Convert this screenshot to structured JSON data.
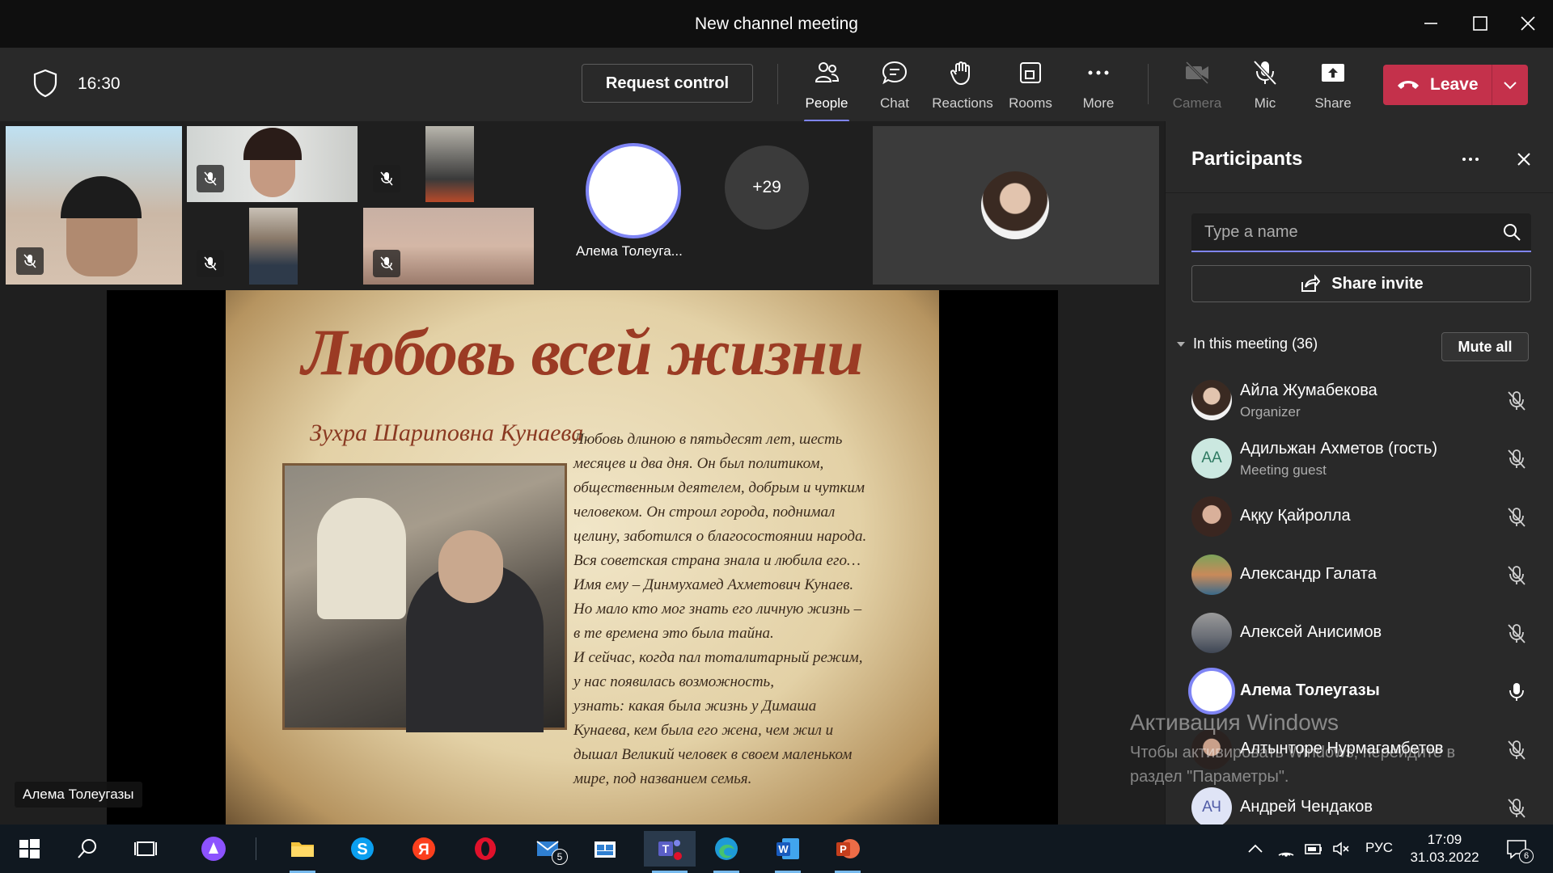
{
  "window": {
    "title": "New channel meeting"
  },
  "toolbar": {
    "timer": "16:30",
    "request_control": "Request control",
    "items": [
      {
        "label": "People",
        "icon": "people-icon",
        "active": true
      },
      {
        "label": "Chat",
        "icon": "chat-icon"
      },
      {
        "label": "Reactions",
        "icon": "reactions-icon"
      },
      {
        "label": "Rooms",
        "icon": "rooms-icon"
      },
      {
        "label": "More",
        "icon": "more-icon"
      },
      {
        "label": "Camera",
        "icon": "camera-off-icon",
        "disabled": true
      },
      {
        "label": "Mic",
        "icon": "mic-off-icon"
      },
      {
        "label": "Share",
        "icon": "share-icon"
      }
    ],
    "leave": "Leave"
  },
  "stage": {
    "featured_name": "Алема Толеуга...",
    "overflow_count": "+29",
    "presenter_tag": "Алема Толеугазы"
  },
  "slide": {
    "title": "Любовь всей жизни",
    "subtitle": "Зухра Шариповна Кунаева",
    "lines": [
      "Любовь длиною в пятьдесят лет, шесть",
      "месяцев и два дня. Он был политиком,",
      "общественным деятелем, добрым и чутким",
      "человеком. Он строил города, поднимал",
      "целину, заботился о благосостоянии народа.",
      "Вся советская страна знала и любила его…",
      "Имя ему – Динмухамед Ахметович Кунаев.",
      "Но мало кто мог знать его личную жизнь –",
      "в те времена это была тайна.",
      "И сейчас, когда пал тоталитарный режим,",
      "у нас появилась возможность,",
      "узнать: какая была жизнь у Димаша",
      "Кунаева, кем была его жена, чем жил и",
      "дышал Великий человек в своем маленьком",
      "мире, под названием семья."
    ]
  },
  "panel": {
    "title": "Participants",
    "search_placeholder": "Type a name",
    "share_invite": "Share invite",
    "section_label": "In this meeting (36)",
    "mute_all": "Mute all",
    "participants": [
      {
        "name": "Айла Жумабекова",
        "sub": "Organizer",
        "avatar": "photo",
        "mic": "off"
      },
      {
        "name": "Адильжан Ахметов (гость)",
        "sub": "Meeting guest",
        "avatar": "initials",
        "initials": "АА",
        "mic": "off"
      },
      {
        "name": "Аққу Қайролла",
        "sub": "",
        "avatar": "photo",
        "mic": "off"
      },
      {
        "name": "Александр Галата",
        "sub": "",
        "avatar": "photo",
        "mic": "off"
      },
      {
        "name": "Алексей Анисимов",
        "sub": "",
        "avatar": "photo",
        "mic": "off"
      },
      {
        "name": "Алема Толеугазы",
        "sub": "",
        "avatar": "ring",
        "mic": "on"
      },
      {
        "name": "Алтынторе Нурмагамбетов",
        "sub": "",
        "avatar": "photo",
        "mic": "off"
      },
      {
        "name": "Андрей Чендаков",
        "sub": "",
        "avatar": "initials",
        "initials": "АЧ",
        "mic": "off"
      }
    ]
  },
  "watermark": {
    "line1": "Активация Windows",
    "line2": "Чтобы активировать Windows, перейдите в раздел \"Параметры\"."
  },
  "taskbar": {
    "lang": "РУС",
    "time": "17:09",
    "date": "31.03.2022",
    "mail_badge": "5",
    "notif_badge": "6"
  },
  "colors": {
    "accent": "#7f85f5",
    "leave": "#c4314b",
    "panel_bg": "#292929",
    "titlebar_bg": "#0f0f0f"
  }
}
